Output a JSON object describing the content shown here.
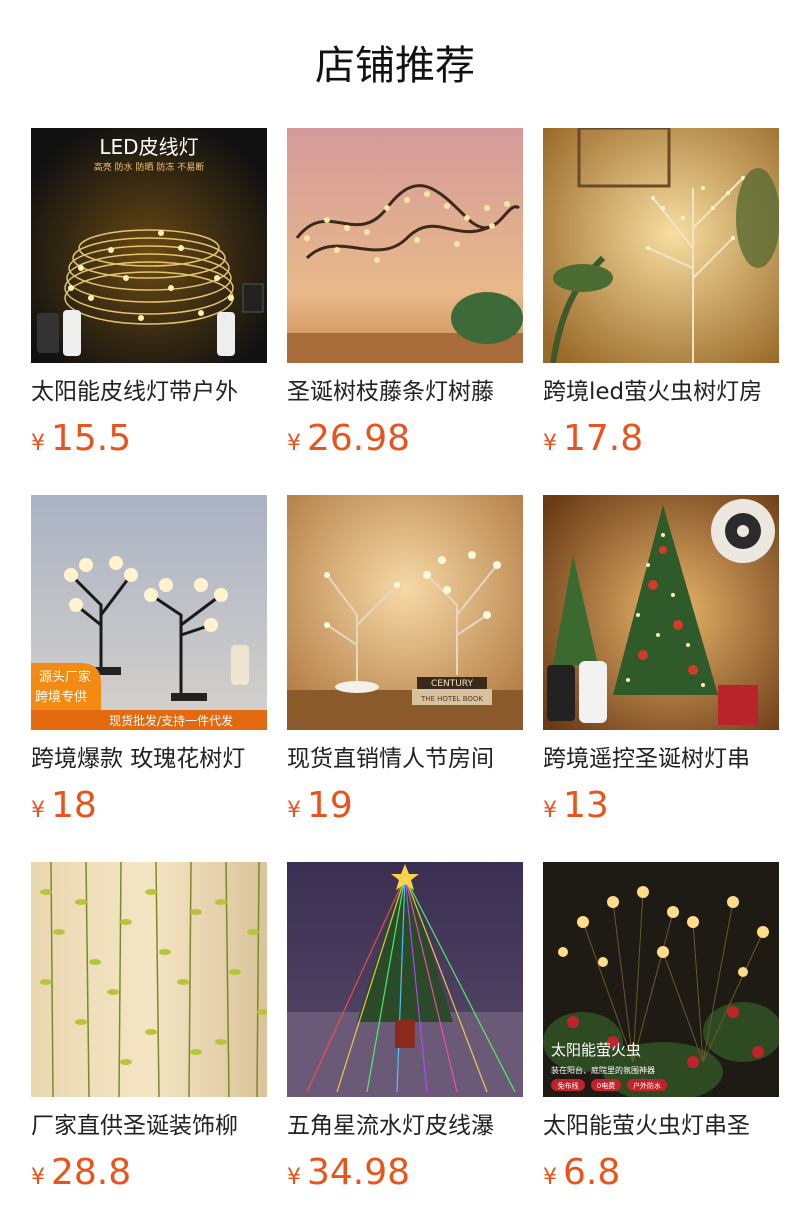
{
  "page": {
    "title": "店铺推荐"
  },
  "products": [
    {
      "name": "太阳能皮线灯带户外",
      "currency": "¥",
      "price": "15.5",
      "image": {
        "overlay_title": "LED皮线灯",
        "overlay_sub": "高亮 防水 防晒 防冻 不易断"
      }
    },
    {
      "name": "圣诞树枝藤条灯树藤",
      "currency": "¥",
      "price": "26.98"
    },
    {
      "name": "跨境led萤火虫树灯房",
      "currency": "¥",
      "price": "17.8"
    },
    {
      "name": "跨境爆款 玫瑰花树灯",
      "currency": "¥",
      "price": "18",
      "image": {
        "badge_line1": "源头厂家",
        "badge_line2": "跨境专供",
        "banner": "现货批发/支持一件代发"
      }
    },
    {
      "name": "现货直销情人节房间",
      "currency": "¥",
      "price": "19",
      "image": {
        "book1": "CENTURY",
        "book2": "THE HOTEL BOOK"
      }
    },
    {
      "name": "跨境遥控圣诞树灯串",
      "currency": "¥",
      "price": "13"
    },
    {
      "name": "厂家直供圣诞装饰柳",
      "currency": "¥",
      "price": "28.8"
    },
    {
      "name": "五角星流水灯皮线瀑",
      "currency": "¥",
      "price": "34.98"
    },
    {
      "name": "太阳能萤火虫灯串圣",
      "currency": "¥",
      "price": "6.8",
      "image": {
        "overlay_title": "太阳能萤火虫",
        "overlay_sub": "装在阳台、庭院里的氛围神器",
        "tag1": "免布线",
        "tag2": "0电费",
        "tag3": "户外防水"
      }
    }
  ],
  "colors": {
    "price": "#e8541b",
    "text": "#222222",
    "title": "#111111"
  }
}
